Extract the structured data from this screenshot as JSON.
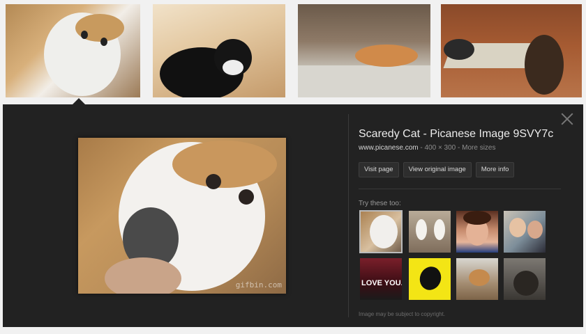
{
  "results": {
    "thumbnails": [
      {
        "name": "kitten-in-hand"
      },
      {
        "name": "black-white-kitten"
      },
      {
        "name": "cat-on-rug"
      },
      {
        "name": "cats-on-wood-floor"
      }
    ]
  },
  "preview": {
    "title": "Scaredy Cat - Picanese Image 9SVY7c",
    "site": "www.picanese.com",
    "dimensions": " - 400 × 300 - ",
    "more_sizes": "More sizes",
    "buttons": {
      "visit_page": "Visit page",
      "view_original": "View original image",
      "more_info": "More info"
    },
    "watermark": "gifbin.com",
    "try_these_label": "Try these too:",
    "copyright": "Image may be subject to copyright.",
    "related": [
      {
        "name": "kitten-in-hand"
      },
      {
        "name": "two-kittens"
      },
      {
        "name": "boy-portrait"
      },
      {
        "name": "couple-in-car"
      },
      {
        "name": "love-you-couple",
        "text": "LOVE YOU."
      },
      {
        "name": "cartoon-cat-yellow"
      },
      {
        "name": "cat-pouncing"
      },
      {
        "name": "dark-cat"
      }
    ]
  }
}
